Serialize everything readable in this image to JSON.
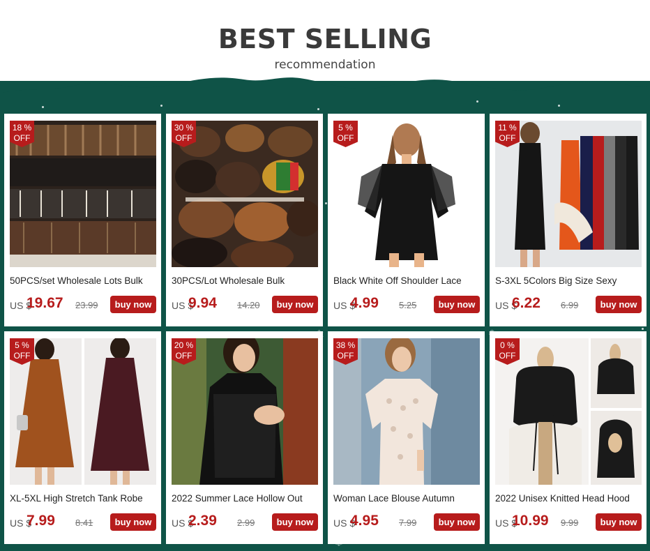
{
  "header": {
    "title": "BEST SELLING",
    "subtitle": "recommendation"
  },
  "colors": {
    "accent": "#b71c1c",
    "background_green": "#0f5347"
  },
  "products": [
    {
      "name": "50PCS/set Wholesale Lots Bulk",
      "discount": "18 %",
      "off": "OFF",
      "currency": "US $",
      "price": "19.67",
      "old_price": "23.99",
      "button": "buy now",
      "image": "leather-bracelets"
    },
    {
      "name": "30PCS/Lot Wholesale Bulk",
      "discount": "30 %",
      "off": "OFF",
      "currency": "US $",
      "price": "9.94",
      "old_price": "14.20",
      "button": "buy now",
      "image": "bracelet-pile"
    },
    {
      "name": "Black White Off Shoulder Lace",
      "discount": "5 %",
      "off": "OFF",
      "currency": "US $",
      "price": "4.99",
      "old_price": "5.25",
      "button": "buy now",
      "image": "black-lace-dress"
    },
    {
      "name": "S-3XL 5Colors Big Size Sexy",
      "discount": "11 %",
      "off": "OFF",
      "currency": "US $",
      "price": "6.22",
      "old_price": "6.99",
      "button": "buy now",
      "image": "tank-dresses"
    },
    {
      "name": "XL-5XL High Stretch Tank Robe",
      "discount": "5 %",
      "off": "OFF",
      "currency": "US $",
      "price": "7.99",
      "old_price": "8.41",
      "button": "buy now",
      "image": "tank-robe"
    },
    {
      "name": "2022 Summer Lace Hollow Out",
      "discount": "20 %",
      "off": "OFF",
      "currency": "US $",
      "price": "2.39",
      "old_price": "2.99",
      "button": "buy now",
      "image": "lace-top-black"
    },
    {
      "name": "Woman Lace Blouse Autumn",
      "discount": "38 %",
      "off": "OFF",
      "currency": "US $",
      "price": "4.95",
      "old_price": "7.99",
      "button": "buy now",
      "image": "lace-blouse-white"
    },
    {
      "name": "2022 Unisex Knitted Head Hood",
      "discount": "0 %",
      "off": "OFF",
      "currency": "US $",
      "price": "10.99",
      "old_price": "9.99",
      "button": "buy now",
      "image": "knitted-hood"
    }
  ]
}
